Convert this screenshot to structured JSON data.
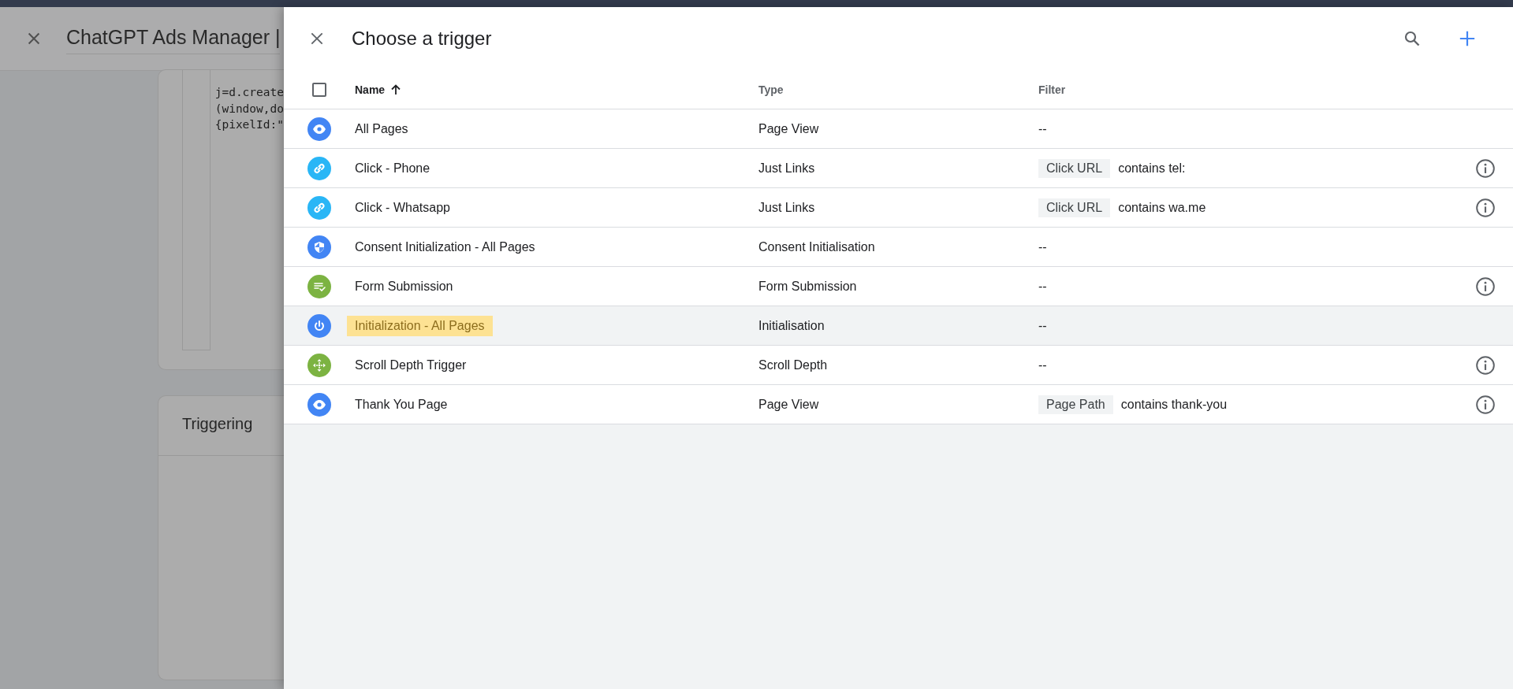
{
  "background_page": {
    "title": "ChatGPT Ads Manager |",
    "code_lines": [
      "j=d.create",
      "(window,do",
      "{pixelId:\""
    ],
    "section_title": "Triggering"
  },
  "panel": {
    "title": "Choose a trigger",
    "columns": [
      {
        "label": "Name",
        "sorted": true
      },
      {
        "label": "Type",
        "sorted": false
      },
      {
        "label": "Filter",
        "sorted": false
      }
    ],
    "select_all": {
      "checked": false
    },
    "rows": [
      {
        "kind": "eye",
        "color": "#4285f4",
        "name": "All Pages",
        "type": "Page View",
        "filter": {
          "text": "--"
        },
        "info": false,
        "selected": false,
        "highlighted": false
      },
      {
        "kind": "link",
        "color": "#29b6f6",
        "name": "Click - Phone",
        "type": "Just Links",
        "filter": {
          "variable": "Click URL",
          "text": "contains tel:"
        },
        "info": true,
        "selected": false,
        "highlighted": false
      },
      {
        "kind": "link",
        "color": "#29b6f6",
        "name": "Click - Whatsapp",
        "type": "Just Links",
        "filter": {
          "variable": "Click URL",
          "text": "contains wa.me"
        },
        "info": true,
        "selected": false,
        "highlighted": false
      },
      {
        "kind": "shield",
        "color": "#4285f4",
        "name": "Consent Initialization - All Pages",
        "type": "Consent Initialisation",
        "filter": {
          "text": "--"
        },
        "info": false,
        "selected": false,
        "highlighted": false
      },
      {
        "kind": "form",
        "color": "#7cb342",
        "name": "Form Submission",
        "type": "Form Submission",
        "filter": {
          "text": "--"
        },
        "info": true,
        "selected": false,
        "highlighted": false
      },
      {
        "kind": "power",
        "color": "#4285f4",
        "name": "Initialization - All Pages",
        "type": "Initialisation",
        "filter": {
          "text": "--"
        },
        "info": false,
        "selected": true,
        "highlighted": true
      },
      {
        "kind": "scroll",
        "color": "#7cb342",
        "name": "Scroll Depth Trigger",
        "type": "Scroll Depth",
        "filter": {
          "text": "--"
        },
        "info": true,
        "selected": false,
        "highlighted": false
      },
      {
        "kind": "eye",
        "color": "#4285f4",
        "name": "Thank You Page",
        "type": "Page View",
        "filter": {
          "variable": "Page Path",
          "text": "contains thank-you"
        },
        "info": true,
        "selected": false,
        "highlighted": false
      }
    ]
  }
}
